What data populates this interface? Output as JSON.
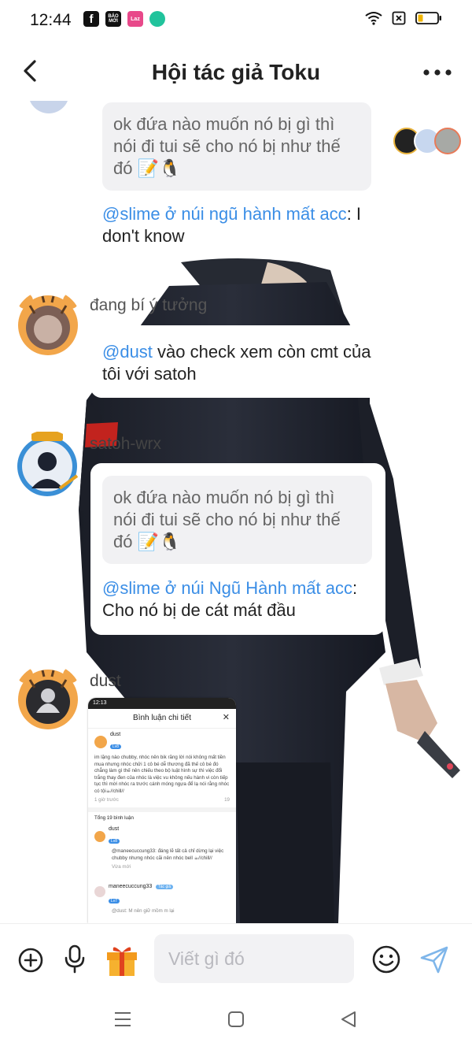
{
  "status": {
    "time": "12:44",
    "app_icons": [
      {
        "name": "facebook-icon",
        "label": "f",
        "color": "#111111"
      },
      {
        "name": "bao-moi-icon",
        "label": "BÁO MỚI",
        "color": "#111111"
      },
      {
        "name": "lazada-icon",
        "label": "Laz",
        "color": "#e8498a"
      },
      {
        "name": "chat-app-icon",
        "label": "",
        "color": "#21c39c"
      }
    ]
  },
  "header": {
    "title": "Hội tác giả Toku"
  },
  "messages": {
    "first": {
      "quote": "ok đứa nào muốn nó bị gì thì nói đi tui sẽ cho nó bị như thế đó 📝🐧",
      "mention": "@slime ở núi ngũ hành mất acc",
      "text": ": I don't know"
    },
    "second": {
      "sender": "đang bí ý tưởng",
      "mention": "@dust",
      "text": " vào check xem còn cmt của tôi với satoh"
    },
    "third": {
      "sender": "satoh-wrx",
      "quote": "ok đứa nào muốn nó bị gì thì nói đi tui sẽ cho nó bị như thế đó 📝🐧",
      "mention": "@slime ở núi Ngũ Hành mất acc",
      "text": ": Cho nó bị de cát mát đầu"
    },
    "fourth": {
      "sender": "dust"
    }
  },
  "screenshot": {
    "time": "12:13",
    "title": "Bình luận chi tiết",
    "comment1": {
      "name": "dust",
      "level": "Lv8",
      "body": "im lặng nào chubby, nhóc nên bik răng lời nói không mất tiền mua nhưng nhóc chửi 1 cô bé dễ thương đã thế cô bé đó chẳng làm gì thế nên chiếu theo bộ luật hình sự thì việc đổi trắng thay đen của nhóc là việc vu không nếu hành vi còn tiếp tục thì mời nhóc ra trước cánh móng ngựa để lạ nói rằng nhóc có tội☕//chill//",
      "time": "1 giờ trước",
      "replies": "19"
    },
    "total": "Tổng 19 bình luận",
    "comment2": {
      "name": "dust",
      "level": "Lv8",
      "body": "@maneecuccung33: đáng lẽ tất cả chỉ dừng lại việc chubby nhưng nhóc cãi nên nhóc bell ☕//chill//",
      "time": "Vừa mới"
    },
    "comment3": {
      "name": "maneecuccung33",
      "badge": "Tác giả",
      "level": "Lv7",
      "body": "@dust: M nên giữ mồm m lại"
    }
  },
  "input": {
    "placeholder": "Viết gì đó"
  },
  "colors": {
    "accent": "#3b8ee6",
    "send": "#7fb6ea"
  }
}
